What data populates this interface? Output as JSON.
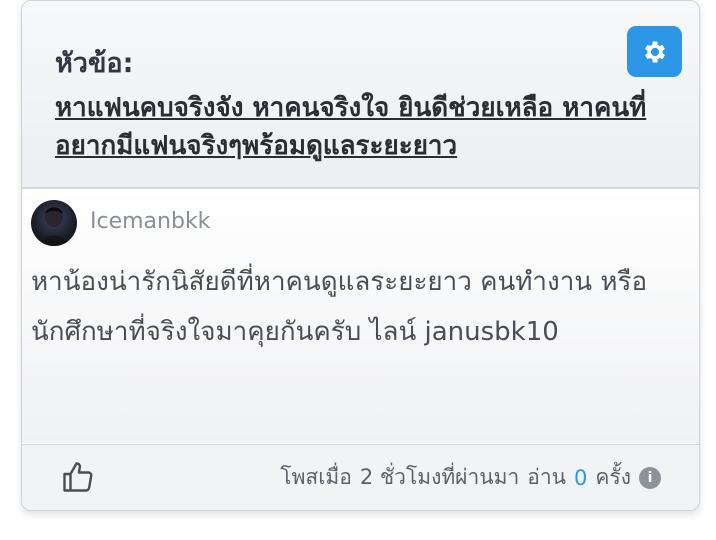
{
  "header": {
    "topic_label": "หัวข้อ:",
    "topic_title": "หาแฟนคบจริงจัง หาคนจริงใจ ยินดีช่วยเหลือ หาคนที่อยากมีแฟนจริงๆพร้อมดูแลระยะยาว"
  },
  "post": {
    "username": "Icemanbkk",
    "text": "หาน้องน่ารักนิสัยดีที่หาคนดูแลระยะยาว คนทำงาน หรือนักศึกษาที่จริงใจมาคุยกันครับ ไลน์ janusbk10"
  },
  "footer": {
    "posted_prefix": "โพสเมื่อ",
    "posted_time": "2 ชั่วโมงที่ผ่านมา",
    "read_label": "อ่าน",
    "view_count": "0",
    "times_label": "ครั้ง"
  },
  "icons": {
    "settings": "gear-icon",
    "like": "thumbs-up-icon",
    "info": "info-icon"
  },
  "colors": {
    "accent": "#2e96e6",
    "text": "#4a4e54"
  }
}
